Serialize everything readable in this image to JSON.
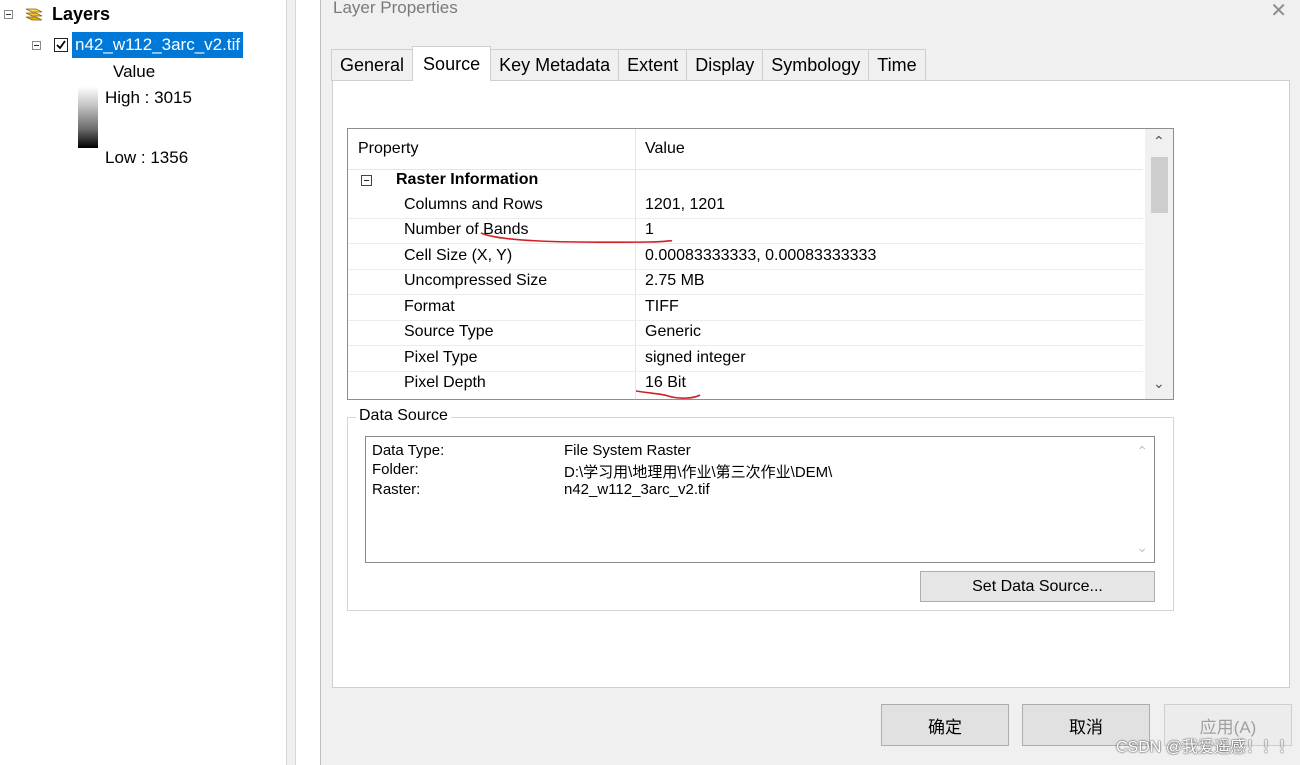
{
  "toc": {
    "title": "Layers",
    "layer_name": "n42_w112_3arc_v2.tif",
    "legend_heading": "Value",
    "high_label": "High : 3015",
    "low_label": "Low : 1356"
  },
  "dialog": {
    "title": "Layer Properties",
    "tabs": [
      {
        "label": "General"
      },
      {
        "label": "Source"
      },
      {
        "label": "Key Metadata"
      },
      {
        "label": "Extent"
      },
      {
        "label": "Display"
      },
      {
        "label": "Symbology"
      },
      {
        "label": "Time"
      }
    ],
    "active_tab": "Source",
    "grid": {
      "col_property": "Property",
      "col_value": "Value",
      "group_title": "Raster Information",
      "rows": [
        {
          "key": "Columns and Rows",
          "value": "1201, 1201"
        },
        {
          "key": "Number of Bands",
          "value": "1"
        },
        {
          "key": "Cell Size (X, Y)",
          "value": "0.00083333333, 0.00083333333"
        },
        {
          "key": "Uncompressed Size",
          "value": "2.75 MB"
        },
        {
          "key": "Format",
          "value": "TIFF"
        },
        {
          "key": "Source Type",
          "value": "Generic"
        },
        {
          "key": "Pixel Type",
          "value": "signed integer"
        },
        {
          "key": "Pixel Depth",
          "value": "16 Bit"
        }
      ]
    },
    "data_source": {
      "legend": "Data Source",
      "lines": [
        {
          "label": "Data Type:",
          "value": "File System Raster"
        },
        {
          "label": "Folder:",
          "value": "D:\\学习用\\地理用\\作业\\第三次作业\\DEM\\"
        },
        {
          "label": "Raster:",
          "value": "n42_w112_3arc_v2.tif"
        }
      ],
      "set_button": "Set Data Source..."
    },
    "buttons": {
      "ok": "确定",
      "cancel": "取消",
      "apply": "应用(A)"
    }
  },
  "watermark": "CSDN @我爱遥感！！！",
  "colors": {
    "selection": "#0078d7",
    "annotation": "#d0202a"
  }
}
